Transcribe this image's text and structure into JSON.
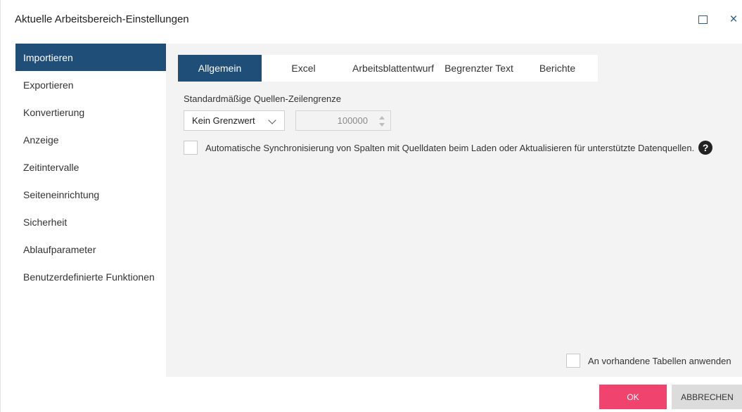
{
  "dialog": {
    "title": "Aktuelle Arbeitsbereich-Einstellungen",
    "maximize_icon": "maximize-icon",
    "close_icon": "close-icon",
    "close_glyph": "×"
  },
  "sidebar": {
    "items": [
      {
        "label": "Importieren",
        "active": true
      },
      {
        "label": "Exportieren",
        "active": false
      },
      {
        "label": "Konvertierung",
        "active": false
      },
      {
        "label": "Anzeige",
        "active": false
      },
      {
        "label": "Zeitintervalle",
        "active": false
      },
      {
        "label": "Seiteneinrichtung",
        "active": false
      },
      {
        "label": "Sicherheit",
        "active": false
      },
      {
        "label": "Ablaufparameter",
        "active": false
      },
      {
        "label": "Benutzerdefinierte Funktionen",
        "active": false
      }
    ]
  },
  "tabs": [
    {
      "label": "Allgemein",
      "active": true
    },
    {
      "label": "Excel",
      "active": false
    },
    {
      "label": "Arbeitsblattentwurf",
      "active": false
    },
    {
      "label": "Begrenzter Text",
      "active": false
    },
    {
      "label": "Berichte",
      "active": false
    }
  ],
  "general": {
    "row_limit_label": "Standardmäßige Quellen-Zeilengrenze",
    "row_limit_select": "Kein Grenzwert",
    "row_limit_value": "100000",
    "auto_sync_label": "Automatische Synchronisierung von Spalten mit Quelldaten beim Laden oder Aktualisieren für unterstützte Datenquellen.",
    "auto_sync_checked": false,
    "help_glyph": "?",
    "apply_existing_label": "An vorhandene Tabellen anwenden",
    "apply_existing_checked": false
  },
  "footer": {
    "ok_label": "OK",
    "cancel_label": "ABBRECHEN"
  },
  "colors": {
    "active_nav": "#1f4e79",
    "ok_button": "#f0436e",
    "cancel_button": "#dcdcdc",
    "panel_bg": "#f3f3f3"
  }
}
